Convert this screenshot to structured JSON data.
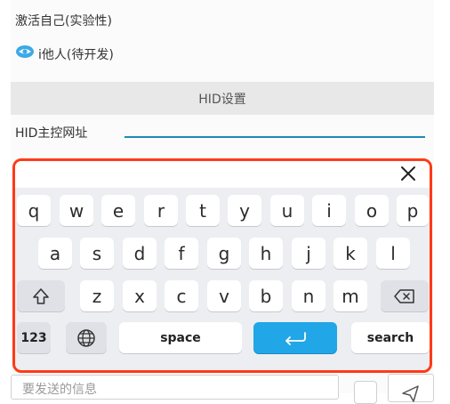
{
  "list": {
    "item1": "激活自己(实验性)",
    "item2": "i他人(待开发)"
  },
  "hid": {
    "section_title": "HID设置",
    "address_label": "HID主控网址",
    "address_value": ""
  },
  "keyboard": {
    "row1": [
      "q",
      "w",
      "e",
      "r",
      "t",
      "y",
      "u",
      "i",
      "o",
      "p"
    ],
    "row2": [
      "a",
      "s",
      "d",
      "f",
      "g",
      "h",
      "j",
      "k",
      "l"
    ],
    "row3": [
      "z",
      "x",
      "c",
      "v",
      "b",
      "n",
      "m"
    ],
    "num_label": "123",
    "space_label": "space",
    "search_label": "search",
    "icons": {
      "close": "close-icon",
      "shift": "shift-icon",
      "backspace": "backspace-icon",
      "globe": "globe-icon",
      "enter": "enter-icon"
    },
    "accent_color": "#ff3a17",
    "enter_color": "#21a6e8"
  },
  "bottom": {
    "message_placeholder": "要发送的信息"
  }
}
